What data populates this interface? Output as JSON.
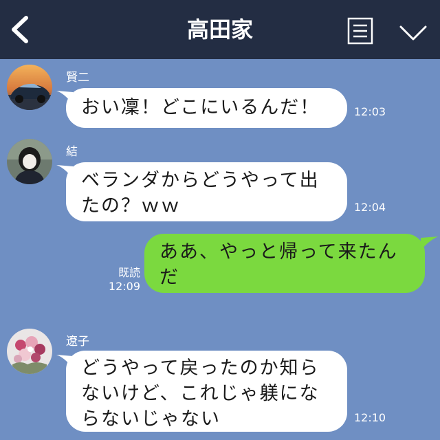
{
  "header": {
    "title": "高田家",
    "back_icon": "chevron-left-icon",
    "menu_icon": "list-icon",
    "expand_icon": "chevron-down-icon"
  },
  "colors": {
    "header_bg": "#232d43",
    "chat_bg": "#6f8fc3",
    "bubble_incoming": "#ffffff",
    "bubble_outgoing": "#7bd93f"
  },
  "messages": [
    {
      "sender": "賢二",
      "text": "おい凜！どこにいるんだ！",
      "time": "12:03"
    },
    {
      "sender": "結",
      "lines": [
        "ベランダからどうやって出",
        "たの？ｗｗ"
      ],
      "time": "12:04"
    },
    {
      "read": "既読",
      "lines": [
        "ああ、やっと帰って来たん",
        "だ"
      ],
      "time": "12:09"
    },
    {
      "sender": "遼子",
      "lines": [
        "どうやって戻ったのか知ら",
        "ないけど、これじゃ躾にな",
        "らないじゃない"
      ],
      "time": "12:10"
    }
  ]
}
